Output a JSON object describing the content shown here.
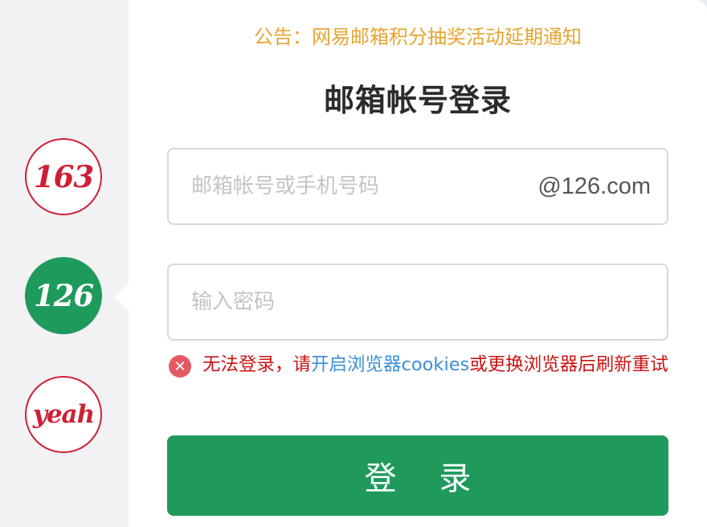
{
  "sidebar": {
    "brands": [
      {
        "label": "163",
        "active": false
      },
      {
        "label": "126",
        "active": true
      },
      {
        "label": "yeah",
        "active": false
      }
    ]
  },
  "notice": "公告：网易邮箱积分抽奖活动延期通知",
  "title": "邮箱帐号登录",
  "account": {
    "placeholder": "邮箱帐号或手机号码",
    "value": "",
    "suffix": "@126.com"
  },
  "password": {
    "placeholder": "输入密码",
    "value": ""
  },
  "error": {
    "prefix": "无法登录，请",
    "link": "开启浏览器cookies",
    "suffix": "或更换浏览器后刷新重试"
  },
  "login_button": "登 录",
  "colors": {
    "brand_red": "#cf1f35",
    "brand_green": "#1e9a5c",
    "notice": "#e6a532",
    "error": "#cc1313",
    "link": "#3a8fd6"
  }
}
